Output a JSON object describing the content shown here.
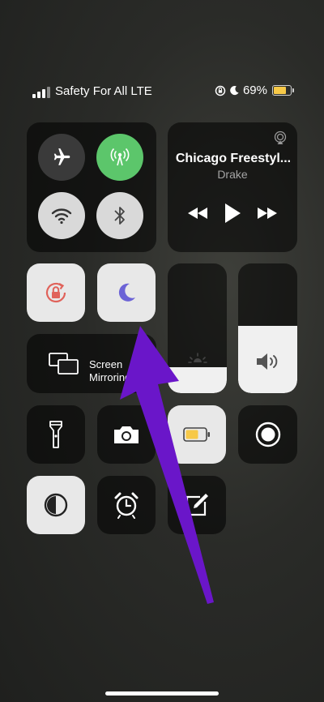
{
  "status_bar": {
    "carrier": "Safety For All LTE",
    "battery_percent": "69%",
    "battery_level": 0.69,
    "icons": [
      "signal-bars-icon",
      "orientation-lock-icon",
      "moon-icon",
      "battery-icon"
    ]
  },
  "connectivity": {
    "airplane_icon": "airplane-icon",
    "cellular_icon": "cellular-data-icon",
    "wifi_icon": "wifi-icon",
    "bluetooth_icon": "bluetooth-icon"
  },
  "now_playing": {
    "title": "Chicago Freestyl...",
    "artist": "Drake",
    "airplay_icon": "airplay-icon",
    "controls": [
      "rewind-icon",
      "play-icon",
      "fast-forward-icon"
    ]
  },
  "toggles": {
    "orientation_lock_icon": "orientation-lock-icon",
    "do_not_disturb_icon": "moon-icon"
  },
  "screen_mirroring": {
    "label_line1": "Screen",
    "label_line2": "Mirroring"
  },
  "sliders": {
    "brightness_level": 0.2,
    "volume_level": 0.52
  },
  "shortcuts": [
    "flashlight-icon",
    "camera-icon",
    "low-power-mode-icon",
    "screen-record-icon",
    "dark-mode-icon",
    "alarm-clock-icon",
    "notes-icon"
  ],
  "colors": {
    "green": "#5cc66b",
    "moon_purple": "#6c63d6",
    "lock_red": "#e0625a",
    "battery_yellow": "#f7c948",
    "annotation_arrow": "#6a16c9"
  }
}
